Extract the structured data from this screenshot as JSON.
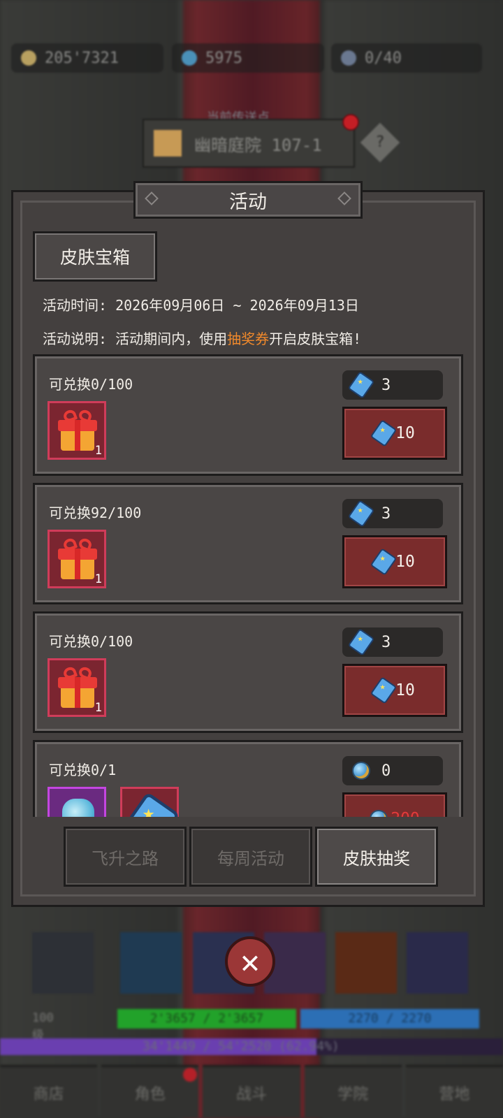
{
  "currencies": [
    {
      "icon": "gold-coin-icon",
      "value": "205'7321"
    },
    {
      "icon": "blue-gem-icon",
      "value": "5975"
    },
    {
      "icon": "feather-icon",
      "value": "0/40"
    }
  ],
  "teleport": {
    "label": "当前传送点",
    "location": "幽暗庭院 107-1",
    "help": "?"
  },
  "dialog": {
    "title": "活动",
    "skin_chest_button": "皮肤宝箱",
    "time_text": "活动时间: 2026年09月06日 ~ 2026年09月13日",
    "desc_prefix": "活动说明: 活动期间内，使用",
    "desc_highlight": "抽奖券",
    "desc_suffix": "开启皮肤宝箱!",
    "cards": [
      {
        "count": "可兑换0/100",
        "have": "3",
        "price": "10",
        "reward_qty": "1"
      },
      {
        "count": "可兑换92/100",
        "have": "3",
        "price": "10",
        "reward_qty": "1"
      },
      {
        "count": "可兑换0/100",
        "have": "3",
        "price": "10",
        "reward_qty": "1"
      },
      {
        "count": "可兑换0/1",
        "have": "0",
        "price": "200"
      }
    ],
    "tabs": [
      "飞升之路",
      "每周活动",
      "皮肤抽奖"
    ],
    "active_tab": "皮肤抽奖"
  },
  "close_symbol": "✕",
  "hud": {
    "level": "100级(24)",
    "hp": "2'3657 / 2'3657",
    "mp": "2270 / 2270",
    "xp": "34'1449 / 54'2520 (62.94%)",
    "xp_fraction": 0.6294,
    "nav": [
      "商店",
      "角色",
      "战斗",
      "学院",
      "营地"
    ]
  },
  "colors": {
    "accent_orange": "#f0892b",
    "buy_button": "#7a2c2c",
    "panel": "#44403f"
  }
}
